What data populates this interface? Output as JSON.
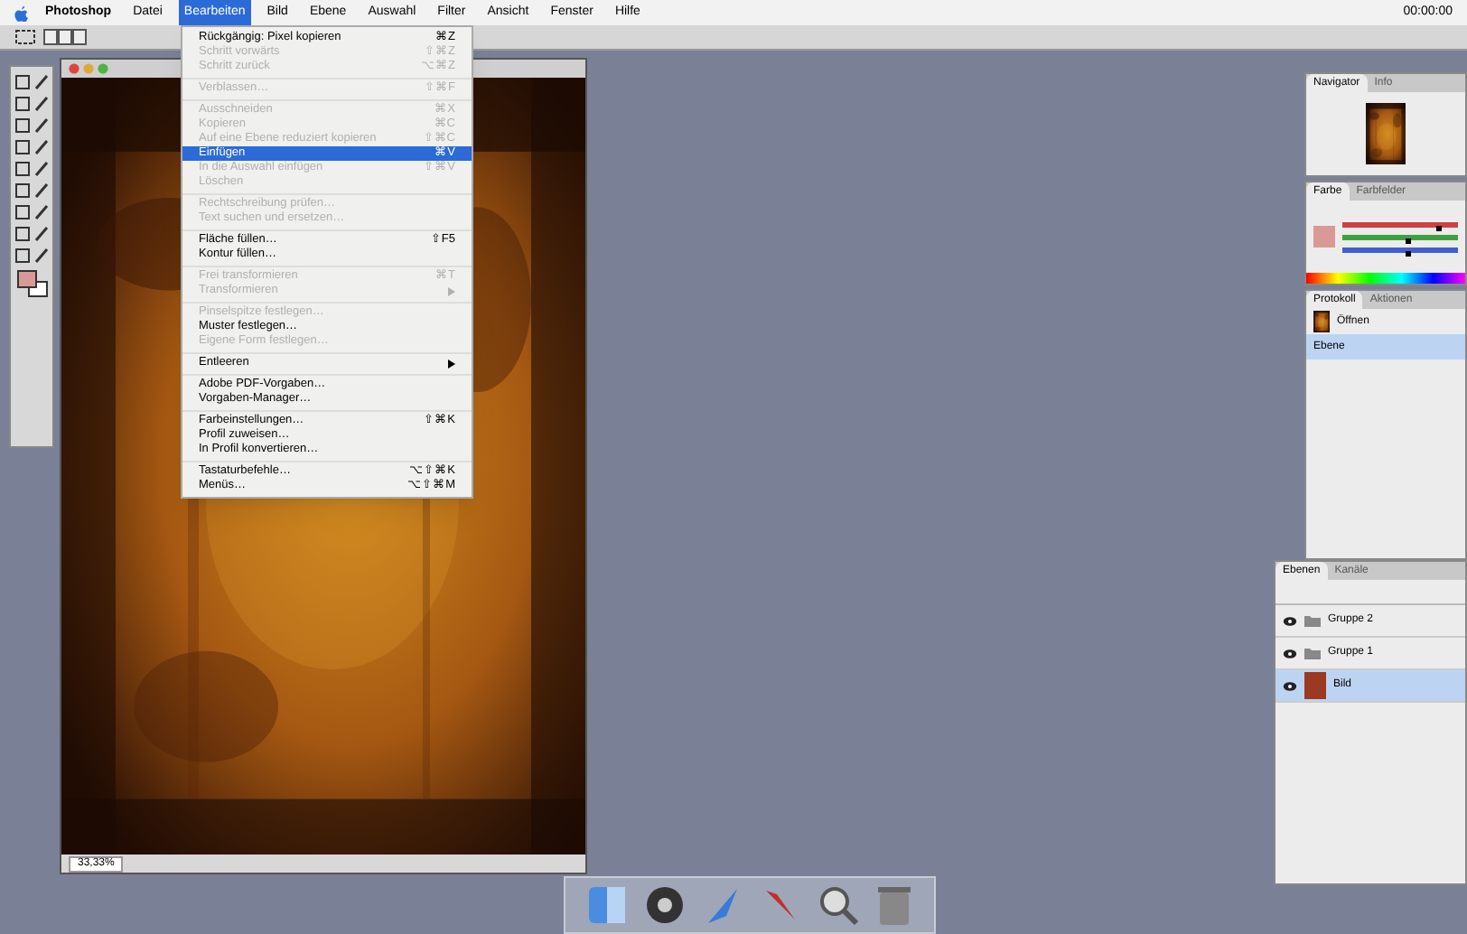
{
  "menubar": {
    "items": [
      {
        "label": "Photoshop",
        "selected": false
      },
      {
        "label": "Datei",
        "selected": false
      },
      {
        "label": "Bearbeiten",
        "selected": true
      },
      {
        "label": "Bild",
        "selected": false
      },
      {
        "label": "Ebene",
        "selected": false
      },
      {
        "label": "Auswahl",
        "selected": false
      },
      {
        "label": "Filter",
        "selected": false
      },
      {
        "label": "Ansicht",
        "selected": false
      },
      {
        "label": "Fenster",
        "selected": false
      },
      {
        "label": "Hilfe",
        "selected": false
      }
    ],
    "clock": "00:00:00"
  },
  "edit_menu": [
    {
      "kind": "item",
      "label": "Rückgängig: Pixel kopieren",
      "shortcut": "⌘Z",
      "disabled": false,
      "selected": false
    },
    {
      "kind": "item",
      "label": "Schritt vorwärts",
      "shortcut": "⇧⌘Z",
      "disabled": true,
      "selected": false
    },
    {
      "kind": "item",
      "label": "Schritt zurück",
      "shortcut": "⌥⌘Z",
      "disabled": true,
      "selected": false
    },
    {
      "kind": "separator"
    },
    {
      "kind": "item",
      "label": "Verblassen…",
      "shortcut": "⇧⌘F",
      "disabled": true,
      "selected": false
    },
    {
      "kind": "separator"
    },
    {
      "kind": "item",
      "label": "Ausschneiden",
      "shortcut": "⌘X",
      "disabled": true,
      "selected": false
    },
    {
      "kind": "item",
      "label": "Kopieren",
      "shortcut": "⌘C",
      "disabled": true,
      "selected": false
    },
    {
      "kind": "item",
      "label": "Auf eine Ebene reduziert kopieren",
      "shortcut": "⇧⌘C",
      "disabled": true,
      "selected": false
    },
    {
      "kind": "item",
      "label": "Einfügen",
      "shortcut": "⌘V",
      "disabled": false,
      "selected": true
    },
    {
      "kind": "item",
      "label": "In die Auswahl einfügen",
      "shortcut": "⇧⌘V",
      "disabled": true,
      "selected": false
    },
    {
      "kind": "item",
      "label": "Löschen",
      "disabled": true,
      "selected": false
    },
    {
      "kind": "separator"
    },
    {
      "kind": "item",
      "label": "Rechtschreibung prüfen…",
      "disabled": true,
      "selected": false
    },
    {
      "kind": "item",
      "label": "Text suchen und ersetzen…",
      "disabled": true,
      "selected": false
    },
    {
      "kind": "separator"
    },
    {
      "kind": "item",
      "label": "Fläche füllen…",
      "shortcut": "⇧F5",
      "disabled": false,
      "selected": false
    },
    {
      "kind": "item",
      "label": "Kontur füllen…",
      "disabled": false,
      "selected": false
    },
    {
      "kind": "separator"
    },
    {
      "kind": "item",
      "label": "Frei transformieren",
      "shortcut": "⌘T",
      "disabled": true,
      "selected": false
    },
    {
      "kind": "submenu",
      "label": "Transformieren",
      "disabled": true,
      "selected": false
    },
    {
      "kind": "separator"
    },
    {
      "kind": "item",
      "label": "Pinselspitze festlegen…",
      "disabled": true,
      "selected": false
    },
    {
      "kind": "item",
      "label": "Muster festlegen…",
      "disabled": false,
      "selected": false
    },
    {
      "kind": "item",
      "label": "Eigene Form festlegen…",
      "disabled": true,
      "selected": false
    },
    {
      "kind": "separator"
    },
    {
      "kind": "submenu",
      "label": "Entleeren",
      "disabled": false,
      "selected": false
    },
    {
      "kind": "separator"
    },
    {
      "kind": "item",
      "label": "Adobe PDF-Vorgaben…",
      "disabled": false,
      "selected": false
    },
    {
      "kind": "item",
      "label": "Vorgaben-Manager…",
      "disabled": false,
      "selected": false
    },
    {
      "kind": "separator"
    },
    {
      "kind": "item",
      "label": "Farbeinstellungen…",
      "shortcut": "⇧⌘K",
      "disabled": false,
      "selected": false
    },
    {
      "kind": "item",
      "label": "Profil zuweisen…",
      "disabled": false,
      "selected": false
    },
    {
      "kind": "item",
      "label": "In Profil konvertieren…",
      "disabled": false,
      "selected": false
    },
    {
      "kind": "separator"
    },
    {
      "kind": "item",
      "label": "Tastaturbefehle…",
      "shortcut": "⌥⇧⌘K",
      "disabled": false,
      "selected": false
    },
    {
      "kind": "item",
      "label": "Menüs…",
      "shortcut": "⌥⇧⌘M",
      "disabled": false,
      "selected": false
    }
  ],
  "document": {
    "zoom": "33,33%"
  },
  "palettes": {
    "navigator_tabs": [
      {
        "label": "Navigator",
        "selected": true
      },
      {
        "label": "Info",
        "selected": false
      }
    ],
    "color_tabs": [
      {
        "label": "Farbe",
        "selected": true
      },
      {
        "label": "Farbfelder",
        "selected": false
      }
    ],
    "color_sliders": [
      {
        "color": "#d04040",
        "level": 0.82
      },
      {
        "color": "#40a040",
        "level": 0.55
      },
      {
        "color": "#4060d0",
        "level": 0.55
      }
    ],
    "history_tabs": [
      {
        "label": "Protokoll",
        "selected": true
      },
      {
        "label": "Aktionen",
        "selected": false
      }
    ],
    "history": [
      {
        "label": "Öffnen",
        "selected": false
      },
      {
        "label": "Ebene",
        "selected": true
      }
    ],
    "layers_tabs": [
      {
        "label": "Ebenen",
        "selected": true
      },
      {
        "label": "Kanäle",
        "selected": false
      }
    ],
    "layers": [
      {
        "kind": "group",
        "label": "Gruppe 2",
        "selected": false
      },
      {
        "kind": "group",
        "label": "Gruppe 1",
        "selected": false
      },
      {
        "kind": "layer",
        "label": "Bild",
        "selected": true
      }
    ]
  }
}
